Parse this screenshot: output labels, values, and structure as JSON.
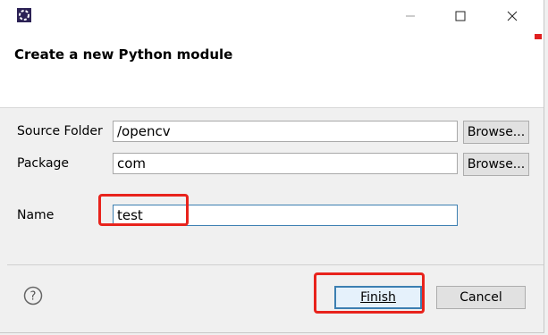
{
  "window": {
    "title_controls": {
      "minimize": "minimize-icon",
      "maximize": "maximize-icon",
      "close": "close-icon"
    }
  },
  "header": {
    "title": "Create a new Python module"
  },
  "form": {
    "source_folder": {
      "label": "Source Folder",
      "value": "/opencv",
      "button": "Browse..."
    },
    "package": {
      "label": "Package",
      "value": "com",
      "button": "Browse..."
    },
    "name": {
      "label": "Name",
      "value": "test"
    }
  },
  "footer": {
    "help_icon": "question-mark-icon",
    "finish_label": "Finish",
    "cancel_label": "Cancel"
  },
  "colors": {
    "annotation": "#e8231c",
    "focus": "#3c7fb1"
  }
}
